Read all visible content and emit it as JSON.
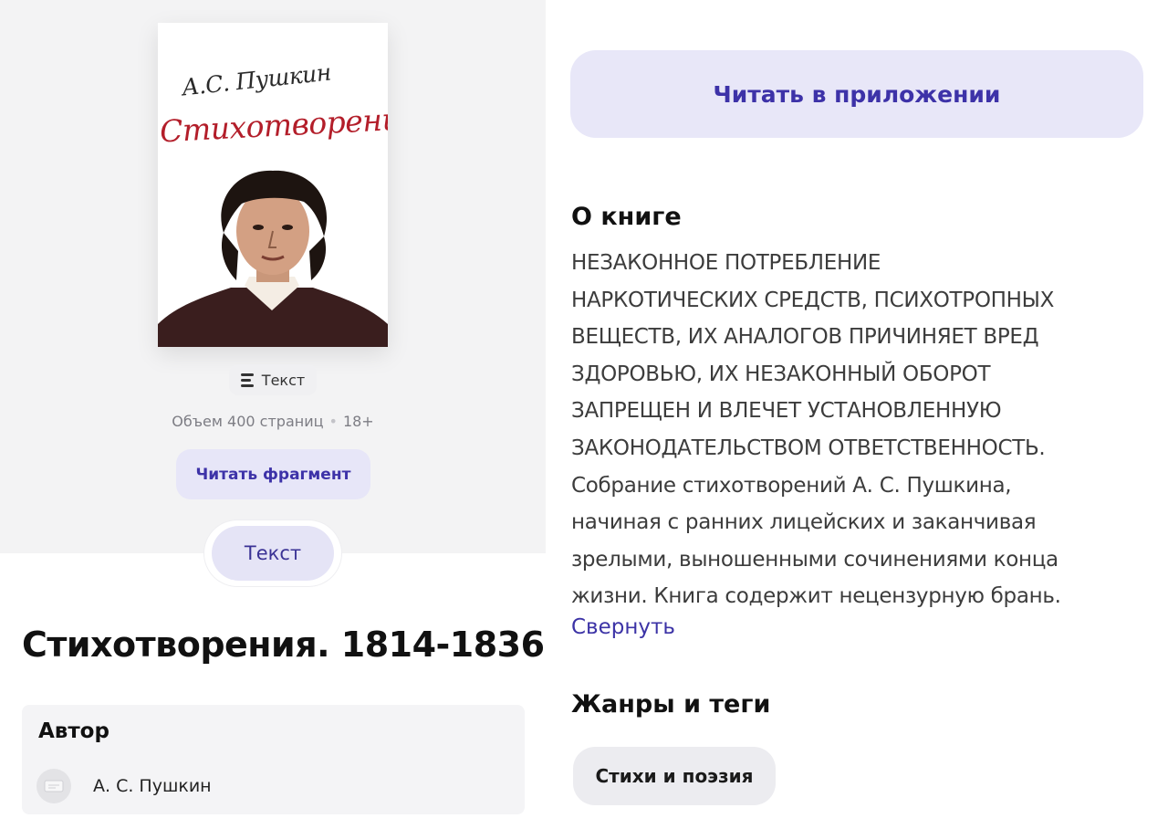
{
  "cover": {
    "author_script": "А.С. Пушкин",
    "title_script": "Стихотворения"
  },
  "format": {
    "label": "Текст",
    "icon": "text-lines-icon"
  },
  "meta": {
    "volume": "Объем 400 страниц",
    "age": "18+"
  },
  "buttons": {
    "read_fragment": "Читать фрагмент",
    "read_in_app": "Читать в приложении"
  },
  "format_toggle": {
    "label": "Текст"
  },
  "book": {
    "title": "Стихотворения. 1814-1836"
  },
  "author_block": {
    "heading": "Автор",
    "name": "А. С. Пушкин"
  },
  "about": {
    "heading": "О книге",
    "lines": [
      "НЕЗАКОННОЕ ПОТРЕБЛЕНИЕ",
      "НАРКОТИЧЕСКИХ СРЕДСТВ, ПСИХОТРОПНЫХ",
      "ВЕЩЕСТВ, ИХ АНАЛОГОВ ПРИЧИНЯЕТ ВРЕД",
      "ЗДОРОВЬЮ, ИХ НЕЗАКОННЫЙ ОБОРОТ",
      "ЗАПРЕЩЕН И ВЛЕЧЕТ УСТАНОВЛЕННУЮ",
      "ЗАКОНОДАТЕЛЬСТВОМ ОТВЕТСТВЕННОСТЬ.",
      "Собрание стихотворений А. С. Пушкина,",
      "начиная с ранних лицейских и заканчивая",
      "зрелыми, выношенными сочинениями конца",
      "жизни. Книга содержит нецензурную брань."
    ],
    "collapse": "Свернуть"
  },
  "genres": {
    "heading": "Жанры и теги",
    "tags": [
      "Стихи и поэзия"
    ]
  },
  "colors": {
    "accent": "#3d32a8",
    "accent_bg": "#e8e7f8",
    "panel_bg": "#f3f3f4"
  }
}
